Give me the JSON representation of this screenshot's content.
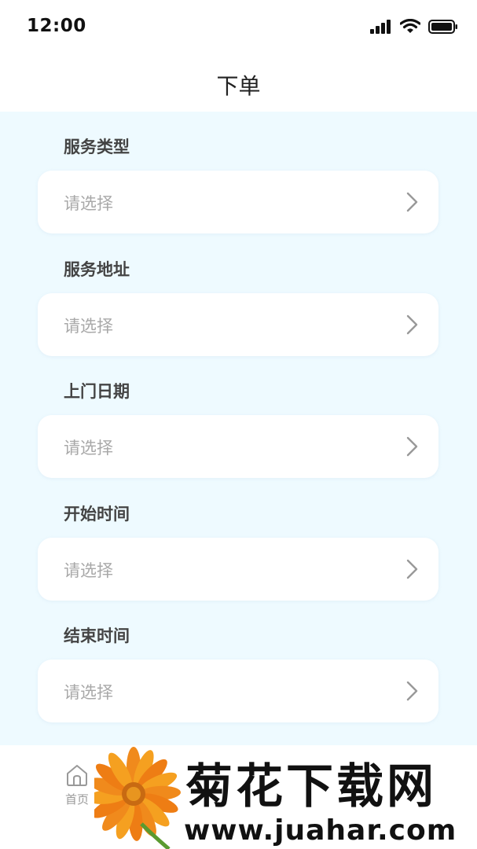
{
  "status_bar": {
    "time": "12:00"
  },
  "nav": {
    "title": "下单"
  },
  "form": {
    "fields": [
      {
        "label": "服务类型",
        "placeholder": "请选择"
      },
      {
        "label": "服务地址",
        "placeholder": "请选择"
      },
      {
        "label": "上门日期",
        "placeholder": "请选择"
      },
      {
        "label": "开始时间",
        "placeholder": "请选择"
      },
      {
        "label": "结束时间",
        "placeholder": "请选择"
      }
    ]
  },
  "tab_bar": {
    "home_label": "首页"
  },
  "watermark": {
    "title": "菊花下载网",
    "url": "www.juahar.com"
  },
  "colors": {
    "content_background": "#eefaff",
    "card": "#ffffff",
    "placeholder": "#a8a8a8",
    "label": "#444444"
  },
  "icons": {
    "signal": "signal-icon",
    "wifi": "wifi-icon",
    "battery": "battery-icon",
    "chevron": "chevron-right-icon",
    "home": "home-icon",
    "flower": "flower-logo"
  }
}
